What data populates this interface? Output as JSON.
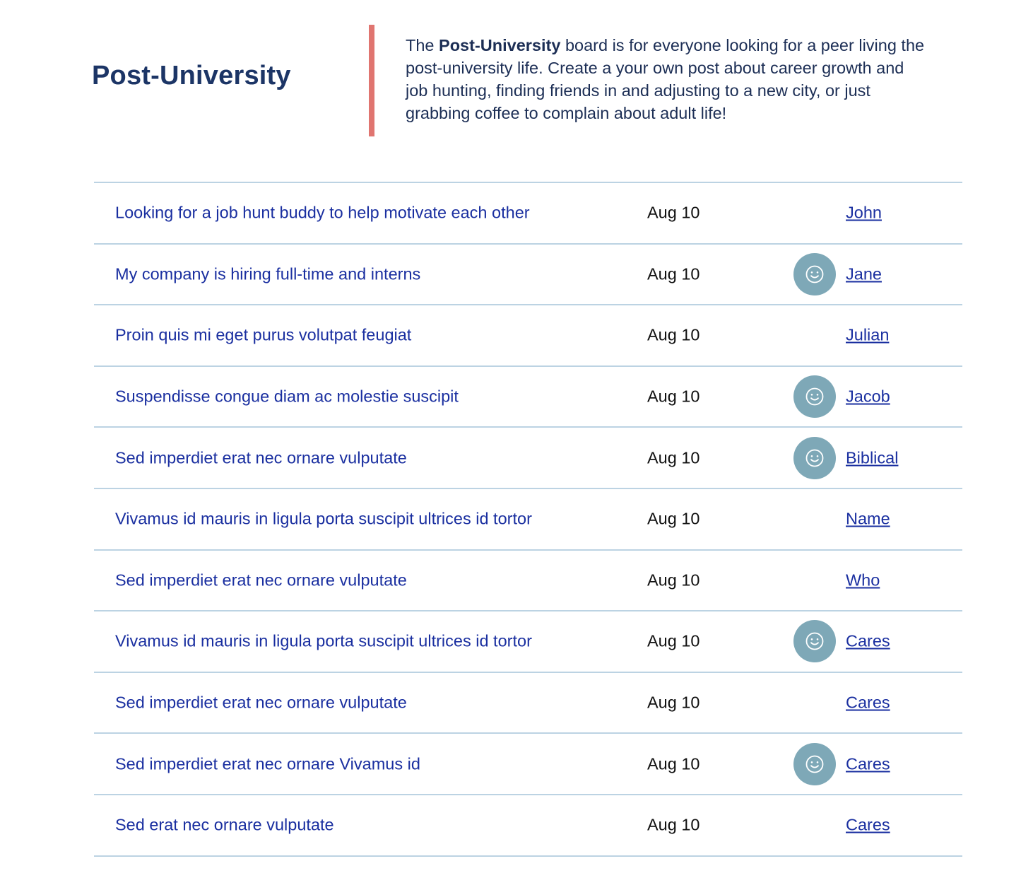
{
  "header": {
    "title": "Post-University",
    "description_prefix": "The ",
    "description_bold": "Post-University",
    "description_suffix": " board is for everyone looking for a peer living the post-university life. Create a your own post about career growth and job hunting, finding friends in and adjusting to a new city, or just grabbing coffee to complain about adult life!"
  },
  "colors": {
    "accent_bar": "#e07570",
    "title": "#1c3566",
    "link": "#1a2fa0",
    "divider": "#bcd3e3",
    "avatar_bg": "#7ea8b7"
  },
  "posts": [
    {
      "title": "Looking for a job hunt buddy to help motivate each other",
      "date": "Aug 10",
      "author": "John",
      "avatar": false
    },
    {
      "title": "My company is hiring full-time and interns",
      "date": "Aug 10",
      "author": "Jane",
      "avatar": true,
      "avatar_icon": "smiley-face-icon"
    },
    {
      "title": "Proin quis mi eget purus volutpat feugiat",
      "date": "Aug 10",
      "author": "Julian",
      "avatar": false
    },
    {
      "title": "Suspendisse congue diam ac molestie suscipit",
      "date": "Aug 10",
      "author": "Jacob",
      "avatar": true,
      "avatar_icon": "smiley-face-icon"
    },
    {
      "title": "Sed imperdiet erat nec ornare vulputate",
      "date": "Aug 10",
      "author": "Biblical",
      "avatar": true,
      "avatar_icon": "smiley-face-icon"
    },
    {
      "title": "Vivamus id mauris in ligula porta suscipit ultrices id tortor",
      "date": "Aug 10",
      "author": "Name",
      "avatar": false
    },
    {
      "title": "Sed imperdiet erat nec ornare vulputate",
      "date": "Aug 10",
      "author": "Who",
      "avatar": false
    },
    {
      "title": "Vivamus id mauris in ligula porta suscipit ultrices id tortor",
      "date": "Aug 10",
      "author": "Cares",
      "avatar": true,
      "avatar_icon": "smiley-face-icon"
    },
    {
      "title": "Sed imperdiet erat nec ornare vulputate",
      "date": "Aug 10",
      "author": "Cares",
      "avatar": false
    },
    {
      "title": "Sed imperdiet erat nec ornare Vivamus id",
      "date": "Aug 10",
      "author": "Cares",
      "avatar": true,
      "avatar_icon": "smiley-face-icon"
    },
    {
      "title": "Sed  erat nec ornare vulputate",
      "date": "Aug 10",
      "author": "Cares",
      "avatar": false
    }
  ]
}
